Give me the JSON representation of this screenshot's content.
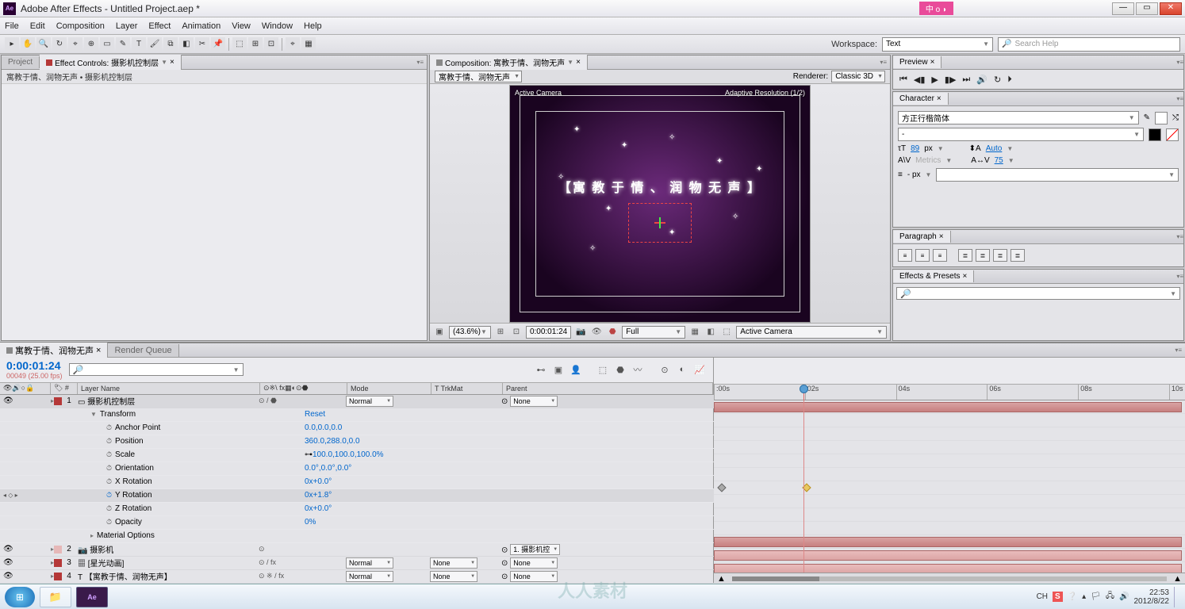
{
  "window": {
    "app_icon": "Ae",
    "title": "Adobe After Effects - Untitled Project.aep *",
    "lang_indicator": "中 o ◗"
  },
  "menubar": [
    "File",
    "Edit",
    "Composition",
    "Layer",
    "Effect",
    "Animation",
    "View",
    "Window",
    "Help"
  ],
  "workspace": {
    "label": "Workspace:",
    "value": "Text"
  },
  "search_help": {
    "placeholder": "Search Help"
  },
  "project_panel": {
    "tab_project": "Project",
    "tab_effect_controls": "Effect Controls: 摄影机控制层",
    "header": "寓教于情、润物无声 • 摄影机控制层"
  },
  "composition": {
    "tab_label": "Composition: 寓教于情、润物无声",
    "comp_name": "寓教于情、润物无声",
    "renderer_label": "Renderer:",
    "renderer_value": "Classic 3D",
    "active_camera": "Active Camera",
    "adaptive": "Adaptive Resolution (1/2)",
    "overlay_text": "【寓 教 于 情 、 润 物 无 声 】"
  },
  "viewer_footer": {
    "mag": "(43.6%)",
    "time": "0:00:01:24",
    "res": "Full",
    "view": "Active Camera"
  },
  "preview": {
    "title": "Preview"
  },
  "character": {
    "title": "Character",
    "font": "方正行楷简体",
    "style": "-",
    "size": "89",
    "size_unit": "px",
    "leading": "Auto",
    "kerning": "Metrics",
    "tracking": "75",
    "stroke": "- px"
  },
  "paragraph": {
    "title": "Paragraph"
  },
  "effects_presets": {
    "title": "Effects & Presets",
    "search_placeholder": ""
  },
  "timeline": {
    "tab_comp": "寓教于情、润物无声",
    "tab_render_queue": "Render Queue",
    "timecode": "0:00:01:24",
    "fps": "00049 (25.00 fps)",
    "ruler": [
      ":00s",
      "02s",
      "04s",
      "06s",
      "08s",
      "10s"
    ],
    "columns": {
      "source": "Layer Name",
      "mode": "Mode",
      "trkmat": "T  TrkMat",
      "parent": "Parent"
    },
    "layers": [
      {
        "num": "1",
        "color": "#b53838",
        "name": "摄影机控制层",
        "mode": "Normal",
        "parent": "None",
        "has3d": true
      },
      {
        "num": "2",
        "color": "#e6b8b8",
        "name": "摄影机",
        "mode": "",
        "parent": "1. 摄影机控",
        "icon": "📷"
      },
      {
        "num": "3",
        "color": "#b53838",
        "name": "[星光动画]",
        "mode": "Normal",
        "parent": "None",
        "fx": true
      },
      {
        "num": "4",
        "color": "#b53838",
        "name": "【寓教于情、润物无声】",
        "mode": "Normal",
        "parent": "None",
        "fx": true,
        "text": true
      }
    ],
    "transform": {
      "header": "Transform",
      "reset": "Reset",
      "props": [
        {
          "name": "Anchor Point",
          "val": "0.0,0.0,0.0"
        },
        {
          "name": "Position",
          "val": "360.0,288.0,0.0"
        },
        {
          "name": "Scale",
          "val": "100.0,100.0,100.0%",
          "link": true
        },
        {
          "name": "Orientation",
          "val": "0.0°,0.0°,0.0°"
        },
        {
          "name": "X Rotation",
          "val": "0x+0.0°"
        },
        {
          "name": "Y Rotation",
          "val": "0x+1.8°",
          "keyed": true
        },
        {
          "name": "Z Rotation",
          "val": "0x+0.0°"
        },
        {
          "name": "Opacity",
          "val": "0%"
        }
      ],
      "material": "Material Options"
    }
  },
  "taskbar": {
    "time": "22:53",
    "date": "2012/8/22",
    "lang": "CH"
  },
  "watermark": "人人素材"
}
